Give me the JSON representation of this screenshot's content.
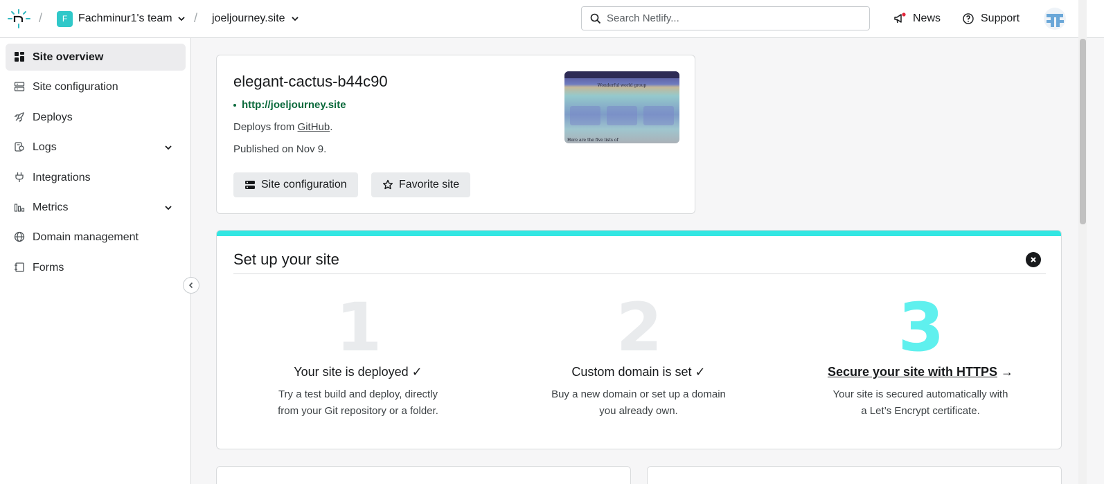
{
  "header": {
    "team_initial": "F",
    "team_name": "Fachminur1's team",
    "site_name": "joeljourney.site",
    "search_placeholder": "Search Netlify...",
    "news_label": "News",
    "support_label": "Support"
  },
  "sidebar": {
    "items": [
      {
        "label": "Site overview",
        "icon": "grid-icon",
        "active": true
      },
      {
        "label": "Site configuration",
        "icon": "server-icon"
      },
      {
        "label": "Deploys",
        "icon": "rocket-icon"
      },
      {
        "label": "Logs",
        "icon": "logs-icon",
        "expandable": true
      },
      {
        "label": "Integrations",
        "icon": "plug-icon"
      },
      {
        "label": "Metrics",
        "icon": "bar-chart-icon",
        "expandable": true
      },
      {
        "label": "Domain management",
        "icon": "globe-icon"
      },
      {
        "label": "Forms",
        "icon": "forms-icon"
      }
    ]
  },
  "site": {
    "name": "elegant-cactus-b44c90",
    "url": "http://joeljourney.site",
    "deploys_prefix": "Deploys from ",
    "deploys_source": "GitHub",
    "deploys_suffix": ".",
    "published": "Published on Nov 9.",
    "config_button": "Site configuration",
    "favorite_button": "Favorite site",
    "thumbnail": {
      "title": "Wonderful world group",
      "footer": "Here are the five lists of"
    }
  },
  "setup": {
    "title": "Set up your site",
    "steps": [
      {
        "number": "1",
        "heading": "Your site is deployed ✓",
        "description": "Try a test build and deploy, directly from your Git repository or a folder."
      },
      {
        "number": "2",
        "heading": "Custom domain is set ✓",
        "description": "Buy a new domain or set up a domain you already own."
      },
      {
        "number": "3",
        "heading": "Secure your site with HTTPS",
        "heading_suffix": " →",
        "description": "Your site is secured automatically with a Let’s Encrypt certificate."
      }
    ]
  },
  "colors": {
    "accent_teal": "#32e6e2",
    "link_green": "#0b6a3c",
    "team_avatar": "#30c8c9"
  }
}
